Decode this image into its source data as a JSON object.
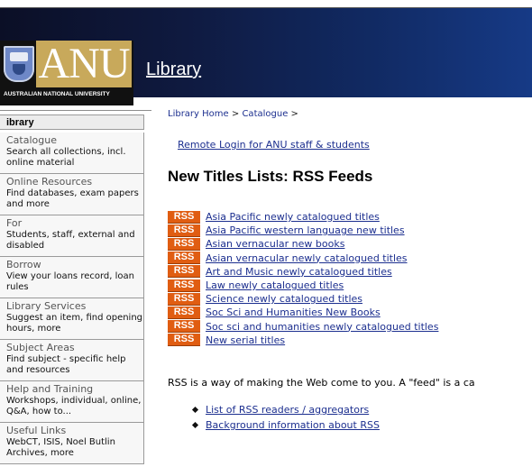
{
  "header": {
    "logo_text": "ANU",
    "logo_subtitle": "AUSTRALIAN NATIONAL UNIVERSITY",
    "section_title": "Library"
  },
  "sidebar": {
    "heading": "ibrary",
    "items": [
      {
        "title": "Catalogue",
        "desc": "Search all collections, incl. online material"
      },
      {
        "title": "Online Resources",
        "desc": "Find databases, exam papers and more"
      },
      {
        "title": "For",
        "desc": "Students, staff, external and disabled"
      },
      {
        "title": "Borrow",
        "desc": "View your loans record, loan rules"
      },
      {
        "title": "Library Services",
        "desc": "Suggest an item, find opening hours, more"
      },
      {
        "title": "Subject Areas",
        "desc": "Find subject - specific help and resources"
      },
      {
        "title": "Help and Training",
        "desc": "Workshops, individual, online, Q&A, how to..."
      },
      {
        "title": "Useful Links",
        "desc": "WebCT, ISIS, Noel Butlin Archives, more"
      }
    ]
  },
  "breadcrumb": {
    "home": "Library Home",
    "sep1": ">",
    "catalogue": "Catalogue",
    "sep2": ">"
  },
  "remote_login": "Remote Login for ANU staff & students",
  "page_title": "New Titles Lists: RSS Feeds",
  "rss_badge": "RSS",
  "feeds": [
    "Asia Pacific newly catalogued titles",
    "Asia Pacific western language new titles",
    "Asian vernacular new books",
    "Asian vernacular newly catalogued titles",
    "Art and Music newly catalogued titles",
    "Law newly catalogued titles",
    "Science newly catalogued titles",
    "Soc Sci and Humanities New Books",
    "Soc sci and humanities newly catalogued titles",
    "New serial titles"
  ],
  "description": "RSS is a way of making the Web come to you. A \"feed\" is a ca",
  "links": [
    "List of RSS readers / aggregators",
    "Background information about RSS"
  ],
  "colors": {
    "rss_orange": "#e05d12",
    "link_blue": "#1c2f8f",
    "anu_gold": "#c8a95b"
  }
}
